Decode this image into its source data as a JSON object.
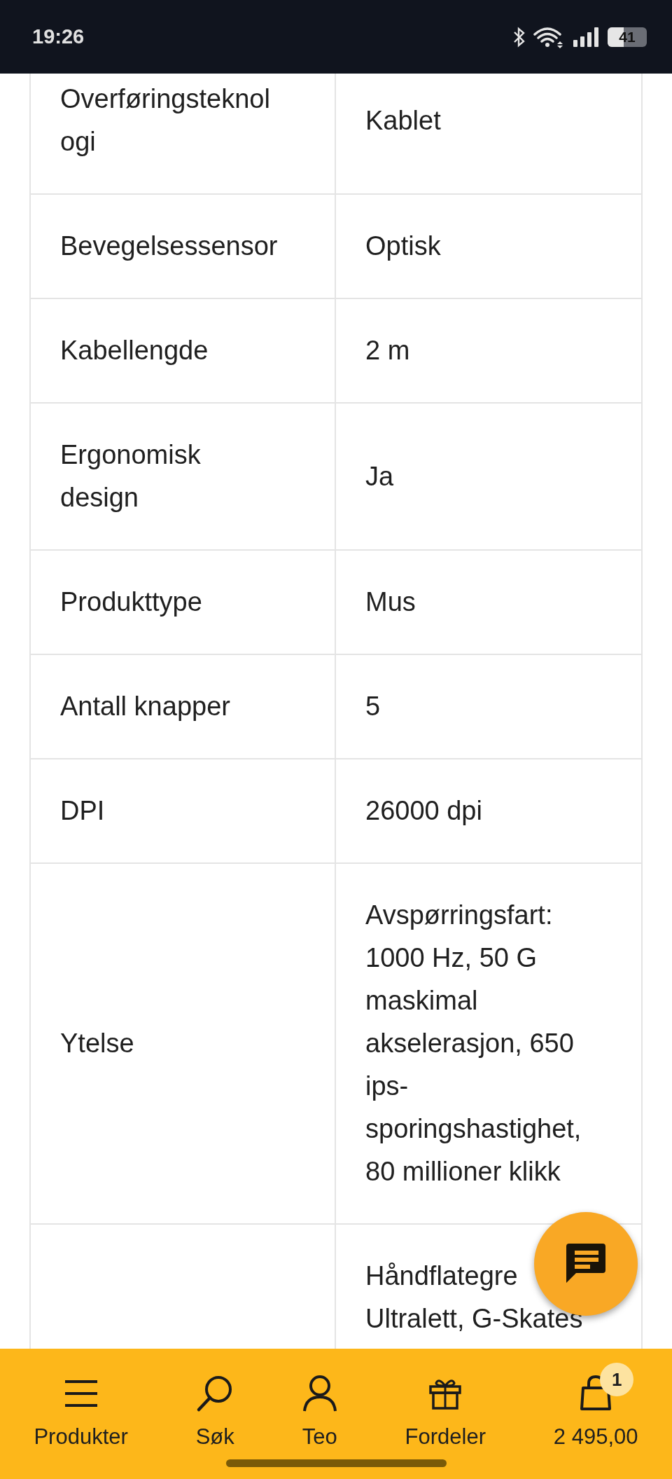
{
  "status_bar": {
    "time": "19:26",
    "battery": "41"
  },
  "specs": [
    {
      "label": [
        "Overføringsteknol",
        "ogi"
      ],
      "value": [
        "Kablet"
      ]
    },
    {
      "label": [
        "Bevegelsessensor"
      ],
      "value": [
        "Optisk"
      ]
    },
    {
      "label": [
        "Kabellengde"
      ],
      "value": [
        "2 m"
      ]
    },
    {
      "label": [
        "Ergonomisk",
        "design"
      ],
      "value": [
        "Ja"
      ]
    },
    {
      "label": [
        "Produkttype"
      ],
      "value": [
        "Mus"
      ]
    },
    {
      "label": [
        "Antall knapper"
      ],
      "value": [
        "5"
      ]
    },
    {
      "label": [
        "DPI"
      ],
      "value": [
        "26000 dpi"
      ]
    },
    {
      "label": [
        "Ytelse"
      ],
      "value": [
        "Avspørringsfart:",
        "1000 Hz, 50 G",
        "maskimal",
        "akselerasjon, 650",
        "ips-",
        "sporingshastighet,",
        "80 millioner klikk"
      ]
    },
    {
      "value": [
        "Håndflategre",
        "Ultralett, G-Skates"
      ]
    }
  ],
  "bottom_nav": [
    {
      "kind": "menu",
      "label": "Produkter"
    },
    {
      "kind": "search",
      "label": "Søk"
    },
    {
      "kind": "user",
      "label": "Teo"
    },
    {
      "kind": "gift",
      "label": "Fordeler"
    },
    {
      "kind": "cart",
      "label": "2 495,00",
      "badge": "1"
    }
  ]
}
